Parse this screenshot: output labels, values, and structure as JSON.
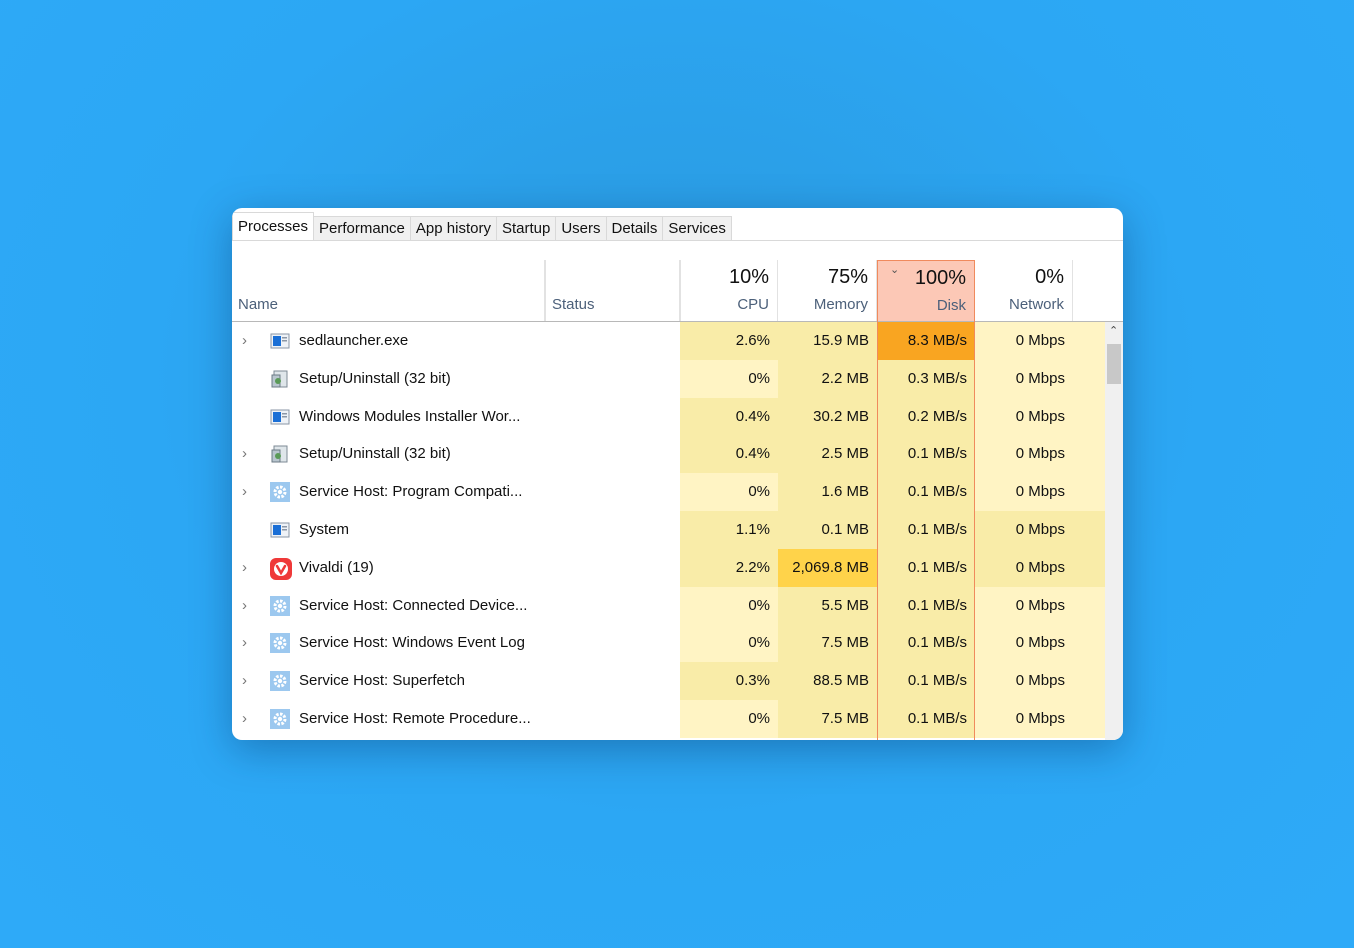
{
  "tabs": [
    "Processes",
    "Performance",
    "App history",
    "Startup",
    "Users",
    "Details",
    "Services"
  ],
  "active_tab": "Processes",
  "columns": {
    "name": "Name",
    "status": "Status",
    "cpu": {
      "pct": "10%",
      "label": "CPU"
    },
    "memory": {
      "pct": "75%",
      "label": "Memory"
    },
    "disk": {
      "pct": "100%",
      "label": "Disk",
      "sorted": "descending"
    },
    "network": {
      "pct": "0%",
      "label": "Network"
    }
  },
  "colors": {
    "heat_light": "#fff4c4",
    "heat_mid": "#f9eca8",
    "heat_high": "#ffd34a",
    "heat_max": "#f9a521",
    "sorted_header": "#fcc8b6"
  },
  "processes": [
    {
      "name": "sedlauncher.exe",
      "icon": "app-window-icon",
      "expandable": true,
      "cpu": "2.6%",
      "memory": "15.9 MB",
      "disk": "8.3 MB/s",
      "network": "0 Mbps",
      "heat": [
        1,
        1,
        3,
        0
      ]
    },
    {
      "name": "Setup/Uninstall (32 bit)",
      "icon": "installer-icon",
      "expandable": false,
      "cpu": "0%",
      "memory": "2.2 MB",
      "disk": "0.3 MB/s",
      "network": "0 Mbps",
      "heat": [
        0,
        1,
        1,
        0
      ]
    },
    {
      "name": "Windows Modules Installer Wor...",
      "icon": "app-window-icon",
      "expandable": false,
      "cpu": "0.4%",
      "memory": "30.2 MB",
      "disk": "0.2 MB/s",
      "network": "0 Mbps",
      "heat": [
        1,
        1,
        1,
        0
      ]
    },
    {
      "name": "Setup/Uninstall (32 bit)",
      "icon": "installer-icon",
      "expandable": true,
      "cpu": "0.4%",
      "memory": "2.5 MB",
      "disk": "0.1 MB/s",
      "network": "0 Mbps",
      "heat": [
        1,
        1,
        1,
        0
      ]
    },
    {
      "name": "Service Host: Program Compati...",
      "icon": "gear-icon",
      "expandable": true,
      "cpu": "0%",
      "memory": "1.6 MB",
      "disk": "0.1 MB/s",
      "network": "0 Mbps",
      "heat": [
        0,
        1,
        1,
        0
      ]
    },
    {
      "name": "System",
      "icon": "app-window-icon",
      "expandable": false,
      "cpu": "1.1%",
      "memory": "0.1 MB",
      "disk": "0.1 MB/s",
      "network": "0 Mbps",
      "heat": [
        1,
        1,
        1,
        1
      ]
    },
    {
      "name": "Vivaldi (19)",
      "icon": "vivaldi-icon",
      "expandable": true,
      "cpu": "2.2%",
      "memory": "2,069.8 MB",
      "disk": "0.1 MB/s",
      "network": "0 Mbps",
      "heat": [
        1,
        2,
        1,
        1
      ]
    },
    {
      "name": "Service Host: Connected Device...",
      "icon": "gear-icon",
      "expandable": true,
      "cpu": "0%",
      "memory": "5.5 MB",
      "disk": "0.1 MB/s",
      "network": "0 Mbps",
      "heat": [
        0,
        1,
        1,
        0
      ]
    },
    {
      "name": "Service Host: Windows Event Log",
      "icon": "gear-icon",
      "expandable": true,
      "cpu": "0%",
      "memory": "7.5 MB",
      "disk": "0.1 MB/s",
      "network": "0 Mbps",
      "heat": [
        0,
        1,
        1,
        0
      ]
    },
    {
      "name": "Service Host: Superfetch",
      "icon": "gear-icon",
      "expandable": true,
      "cpu": "0.3%",
      "memory": "88.5 MB",
      "disk": "0.1 MB/s",
      "network": "0 Mbps",
      "heat": [
        1,
        1,
        1,
        0
      ]
    },
    {
      "name": "Service Host: Remote Procedure...",
      "icon": "gear-icon",
      "expandable": true,
      "cpu": "0%",
      "memory": "7.5 MB",
      "disk": "0.1 MB/s",
      "network": "0 Mbps",
      "heat": [
        0,
        1,
        1,
        0
      ]
    }
  ]
}
